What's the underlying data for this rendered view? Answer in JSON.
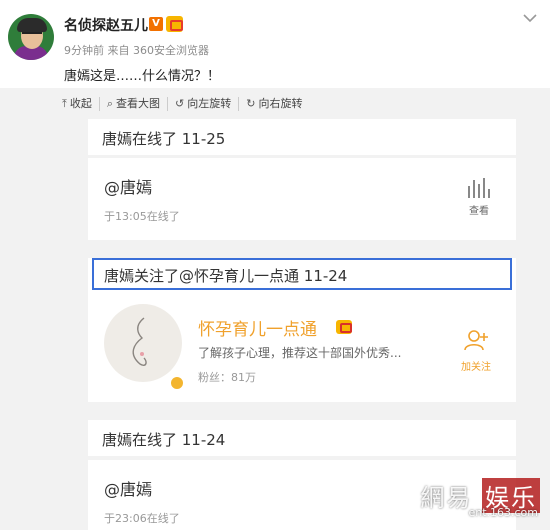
{
  "post": {
    "username": "名侦探赵五儿",
    "verified_badge": "V",
    "meta": "9分钟前 来自 360安全浏览器",
    "text": "唐嫣这是……什么情况？！"
  },
  "toolbar": {
    "items": [
      {
        "icon": "collapse-up-icon",
        "glyph": "⤒",
        "label": "收起"
      },
      {
        "icon": "search-icon",
        "glyph": "⌕",
        "label": "查看大图"
      },
      {
        "icon": "rotate-left-icon",
        "glyph": "↺",
        "label": "向左旋转"
      },
      {
        "icon": "rotate-right-icon",
        "glyph": "↻",
        "label": "向右旋转"
      }
    ]
  },
  "screenshot": {
    "entry1_title": "唐嫣在线了 11-25",
    "card1": {
      "at_name": "@唐嫣",
      "online_time": "于13:05在线了",
      "view_label": "查看"
    },
    "entry2_title": "唐嫣关注了@怀孕育儿一点通 11-24",
    "card2": {
      "account_name": "怀孕育儿一点通",
      "description": "了解孩子心理，推荐这十部国外优秀...",
      "fans": "粉丝：81万",
      "follow_label": "加关注"
    },
    "entry3_title": "唐嫣在线了 11-24",
    "card3": {
      "at_name": "@唐嫣",
      "online_time": "于23:06在线了"
    }
  },
  "watermark": {
    "brand": "網易",
    "brand_box": "娱乐",
    "sub": "ent.163.com"
  },
  "colors": {
    "accent_orange": "#f0a12c",
    "highlight_blue": "#3a6fd8",
    "verified_orange": "#f27100"
  }
}
